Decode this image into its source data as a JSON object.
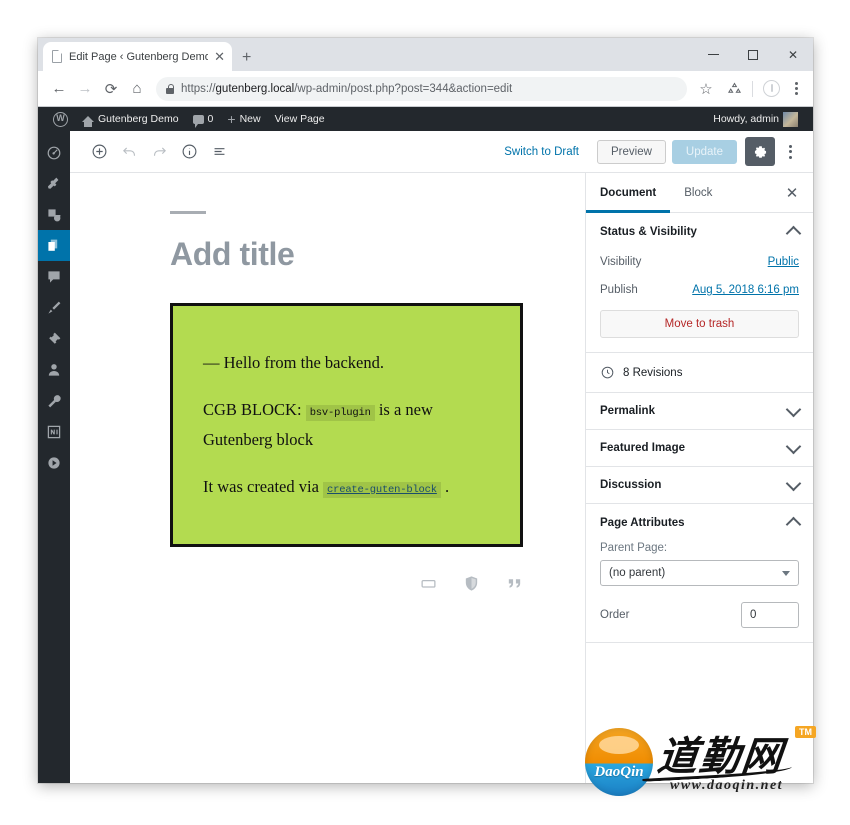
{
  "browser": {
    "tab": {
      "title": "Edit Page ‹ Gutenberg Demo — \\",
      "favicon": "page-icon",
      "close": "✕"
    },
    "new_tab": "+",
    "window_controls": {
      "minimize": "–",
      "maximize": "□",
      "close": "✕"
    },
    "nav": {
      "back": "←",
      "forward": "→",
      "reload": "⟳",
      "home": "⌂"
    },
    "omnibox": {
      "url_scheme": "https://",
      "url_host": "gutenberg.local",
      "url_path": "/wp-admin/post.php?post=344&action=edit",
      "full_url": "https://gutenberg.local/wp-admin/post.php?post=344&action=edit",
      "lock": "lock-icon"
    },
    "toolbar_icons": {
      "bookmark": "☆",
      "extension": "extension-icon",
      "profile": "profile-icon",
      "menu": "⋮"
    }
  },
  "adminbar": {
    "logo": "wordpress-logo",
    "site_name": "Gutenberg Demo",
    "comments_count": "0",
    "new_label": "New",
    "view_page_label": "View Page",
    "howdy": "Howdy, admin"
  },
  "adminmenu": {
    "items": [
      {
        "name": "dashboard",
        "label": "Dashboard",
        "current": false
      },
      {
        "name": "posts",
        "label": "Posts",
        "current": false
      },
      {
        "name": "media",
        "label": "Media",
        "current": false
      },
      {
        "name": "pages",
        "label": "Pages",
        "current": true
      },
      {
        "name": "comments",
        "label": "Comments",
        "current": false
      },
      {
        "name": "appearance",
        "label": "Appearance",
        "current": false
      },
      {
        "name": "plugins",
        "label": "Plugins",
        "current": false
      },
      {
        "name": "users",
        "label": "Users",
        "current": false
      },
      {
        "name": "tools",
        "label": "Tools",
        "current": false
      },
      {
        "name": "settings",
        "label": "Settings",
        "current": false
      },
      {
        "name": "collapse",
        "label": "Collapse menu",
        "current": false
      }
    ]
  },
  "editor_toolbar": {
    "add_block": "inserter-plus-icon",
    "undo": "undo-icon",
    "redo": "redo-icon",
    "info": "info-icon",
    "block_nav": "block-navigation-icon",
    "switch_to_draft": "Switch to Draft",
    "preview": "Preview",
    "update": "Update",
    "settings_gear": "gear-icon",
    "more_menu": "⋮"
  },
  "canvas": {
    "title_placeholder": "Add title",
    "block": {
      "background_color": "#b3db50",
      "border_color": "#111111",
      "lines": [
        {
          "id": "l1",
          "prefix": "— Hello from the backend."
        },
        {
          "id": "l2",
          "pre": "CGB BLOCK: ",
          "code": "bsv-plugin",
          "post": " is a new Gutenberg block"
        },
        {
          "id": "l3",
          "pre": "It was created via ",
          "code": "create-guten-block",
          "post": " ."
        }
      ]
    },
    "block_icons": [
      {
        "name": "paragraph-block-icon"
      },
      {
        "name": "shield-block-icon"
      },
      {
        "name": "quote-block-icon"
      }
    ]
  },
  "inspector": {
    "tabs": [
      {
        "label": "Document",
        "active": true
      },
      {
        "label": "Block",
        "active": false
      }
    ],
    "close": "✕",
    "status_visibility": {
      "title": "Status & Visibility",
      "expanded": true,
      "visibility_label": "Visibility",
      "visibility_value": "Public",
      "publish_label": "Publish",
      "publish_value": "Aug 5, 2018 6:16 pm",
      "trash_label": "Move to trash"
    },
    "revisions": {
      "icon": "clock-icon",
      "label": "8 Revisions"
    },
    "panels": [
      {
        "title": "Permalink",
        "expanded": false
      },
      {
        "title": "Featured Image",
        "expanded": false
      },
      {
        "title": "Discussion",
        "expanded": false
      }
    ],
    "page_attributes": {
      "title": "Page Attributes",
      "expanded": true,
      "parent_label": "Parent Page:",
      "parent_value": "(no parent)",
      "order_label": "Order",
      "order_value": "0"
    }
  },
  "watermark": {
    "brand": "DaoQin",
    "chinese": "道勤网",
    "tm": "TM",
    "url": "www.daoqin.net"
  },
  "colors": {
    "wp_blue": "#0073aa",
    "admin_dark": "#23282d",
    "block_green": "#b3db50"
  }
}
